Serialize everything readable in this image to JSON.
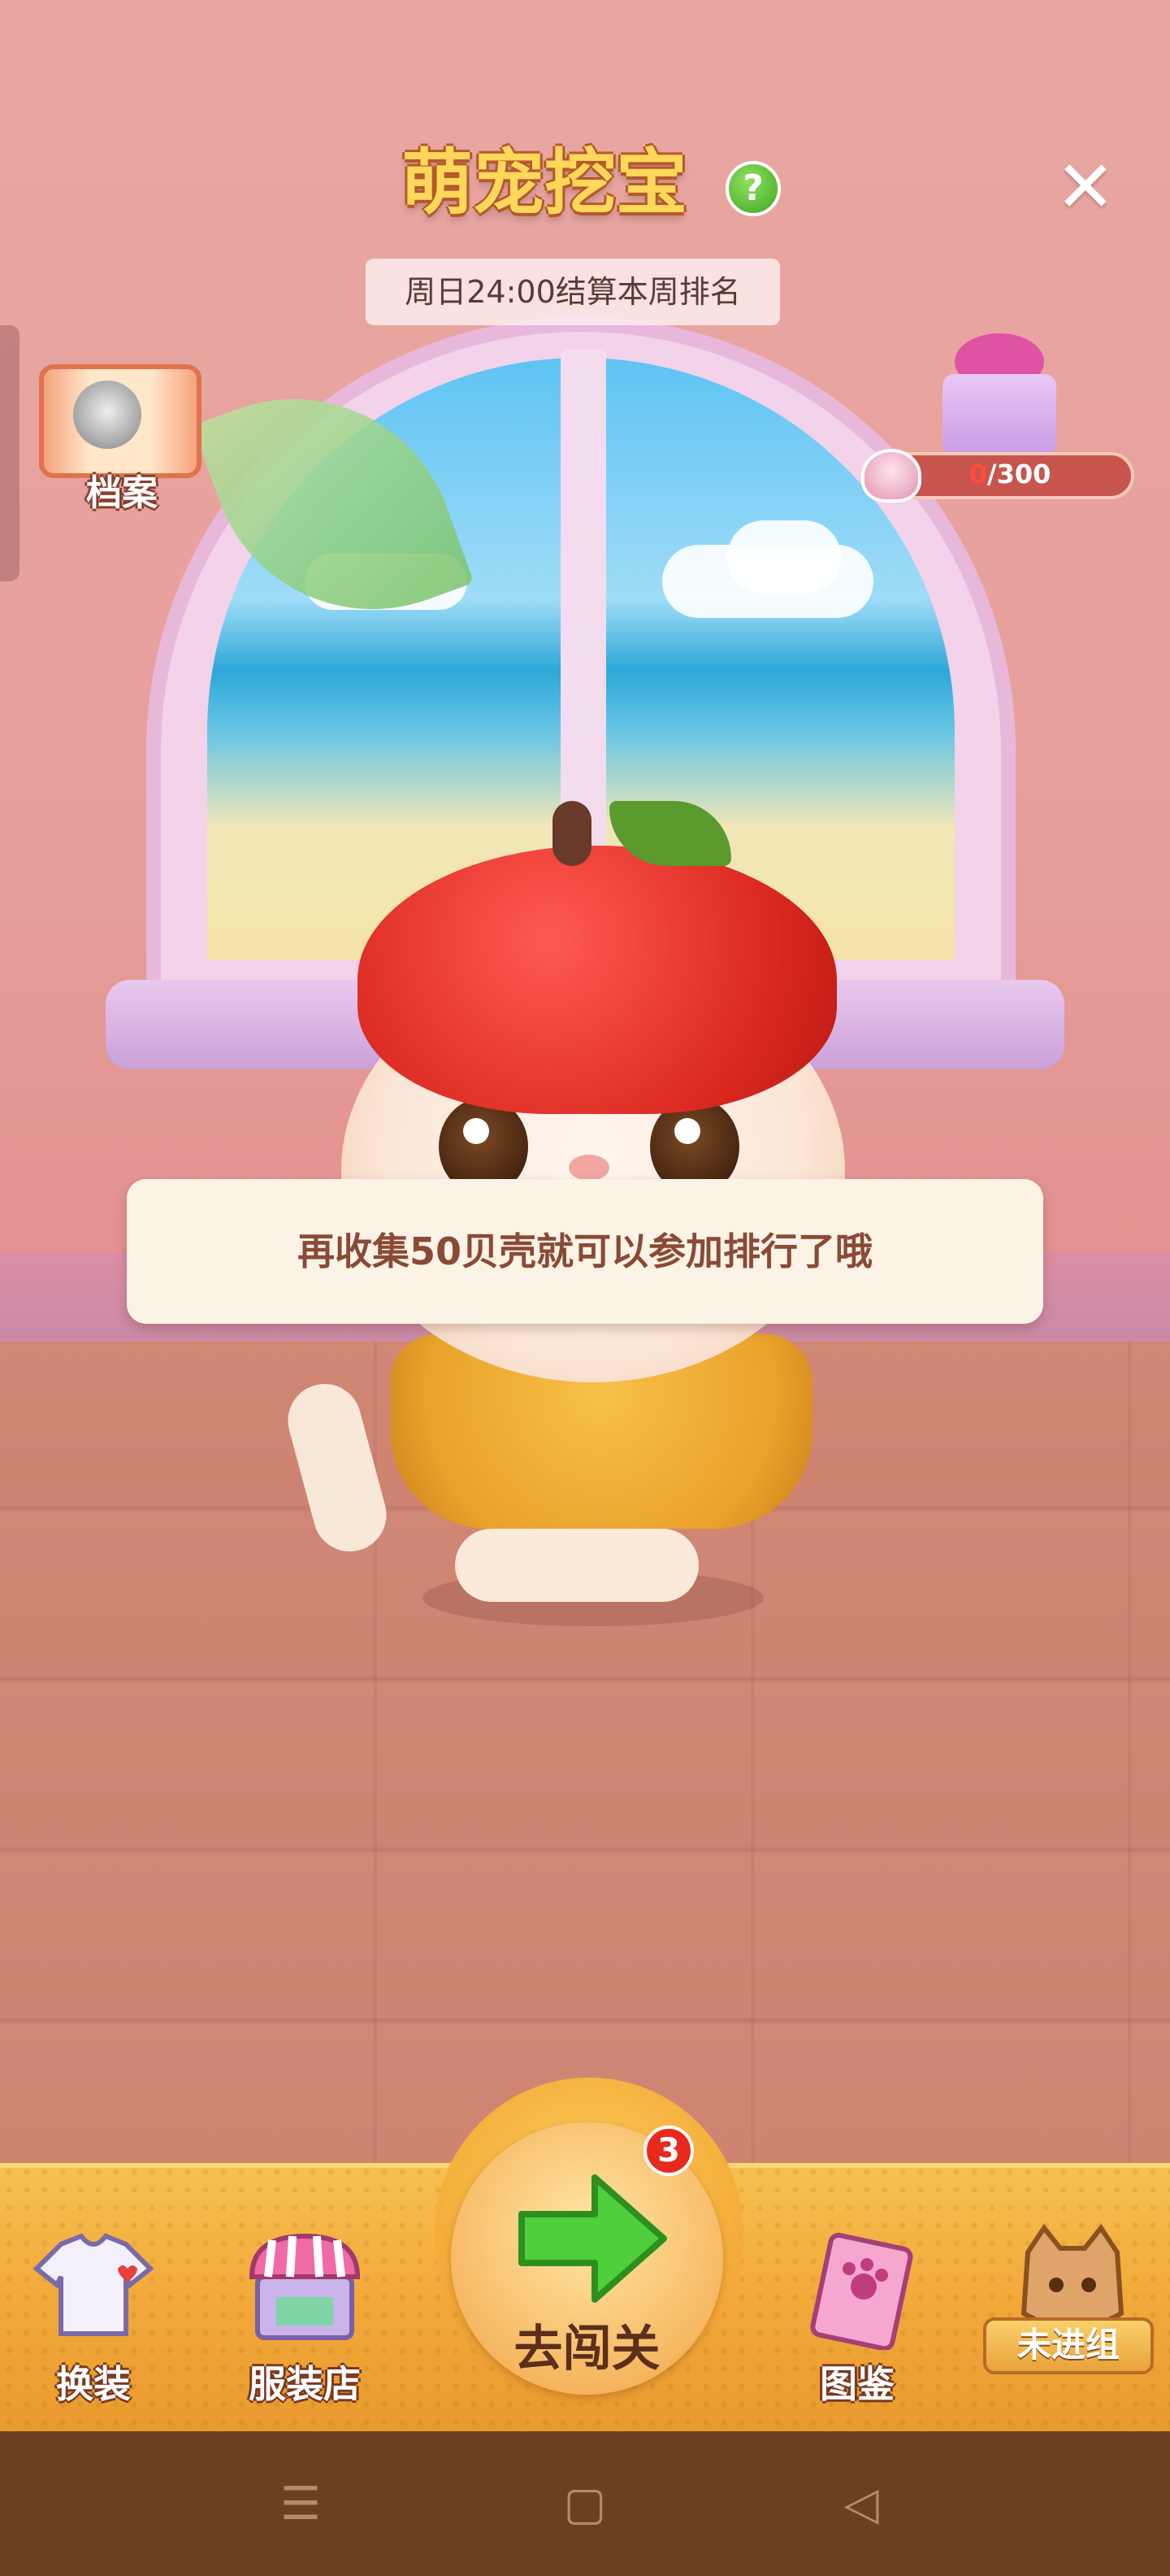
{
  "header": {
    "title": "萌宠挖宝",
    "help_icon_glyph": "?",
    "close_icon_glyph": "✕",
    "subtitle": "周日24:00结算本周排名"
  },
  "profile": {
    "label": "档案"
  },
  "reward": {
    "current": "0",
    "separator": "/",
    "target": "300",
    "fraction": 0
  },
  "message": "再收集50贝壳就可以参加排行了哦",
  "bottom_nav": {
    "dress_up": "换装",
    "shop": "服装店",
    "go_level": "去闯关",
    "go_badge": "3",
    "album": "图鉴",
    "team": "未进组"
  },
  "system_nav": {
    "menu_glyph": "☰",
    "home_glyph": "▢",
    "back_glyph": "◁"
  },
  "colors": {
    "title_fill": "#ffd75a",
    "title_outline": "#b45a2a",
    "bottom_bar": "#f2a93a",
    "badge": "#e8291d"
  }
}
